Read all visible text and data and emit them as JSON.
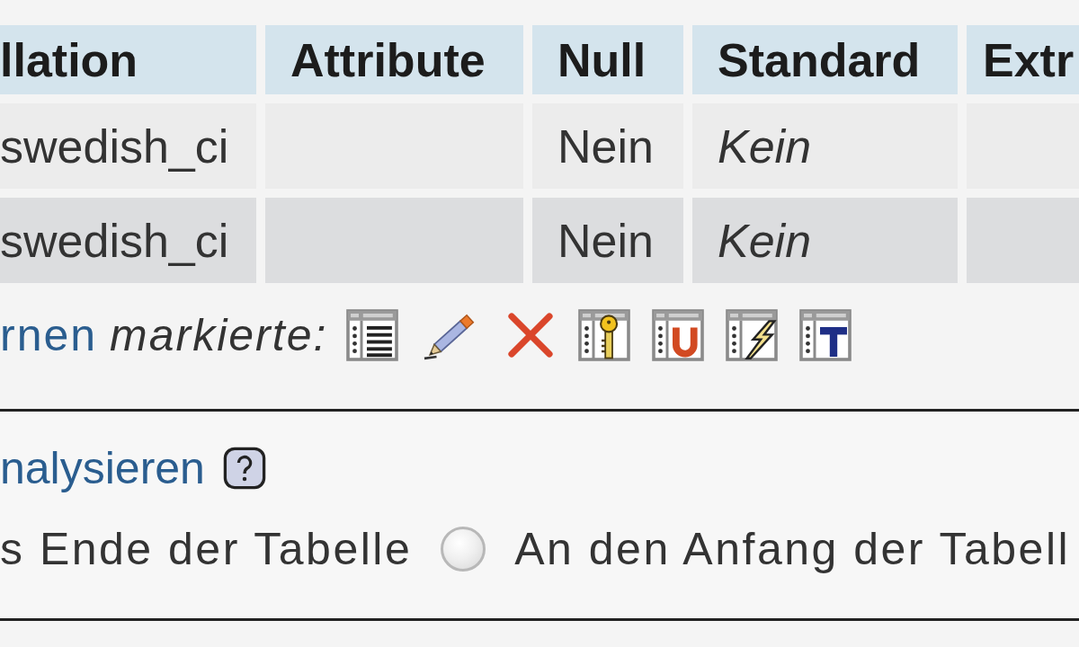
{
  "table": {
    "columns": [
      {
        "label": "llation"
      },
      {
        "label": "Attribute"
      },
      {
        "label": "Null"
      },
      {
        "label": "Standard"
      },
      {
        "label": "Extr"
      }
    ],
    "rows": [
      {
        "cells": [
          {
            "text": "swedish_ci"
          },
          null,
          {
            "text": "Nein"
          },
          {
            "text": "Kein",
            "italic": true
          },
          null
        ]
      },
      {
        "cells": [
          {
            "text": "swedish_ci"
          },
          null,
          {
            "text": "Nein"
          },
          {
            "text": "Kein",
            "italic": true
          },
          null
        ]
      }
    ]
  },
  "with_selected": {
    "link": "rnen",
    "label": "markierte:"
  },
  "structure_tools": {
    "analyze_link": "nalysieren"
  },
  "insert_position": [
    {
      "kind": "label",
      "label": "s Ende der Tabelle"
    },
    {
      "kind": "radio",
      "label": "An den Anfang der Tabell",
      "selected": false
    }
  ]
}
